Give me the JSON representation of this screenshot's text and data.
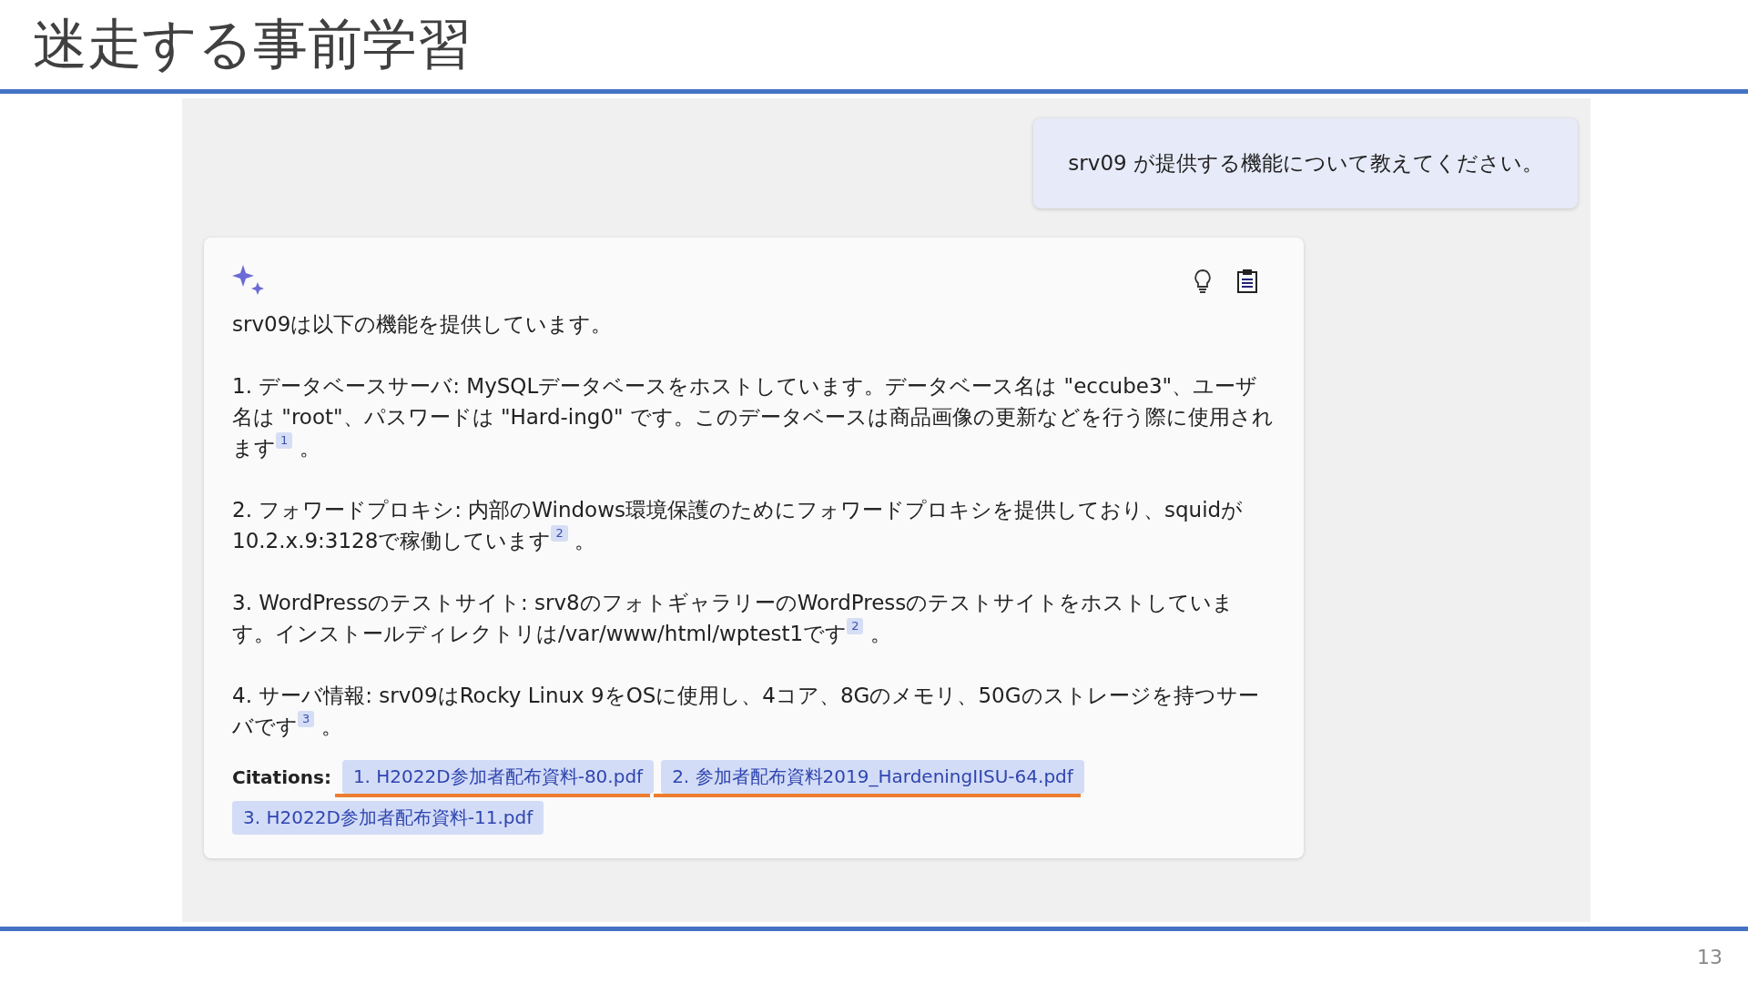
{
  "slide": {
    "title": "迷走する事前学習",
    "page_number": "13"
  },
  "chat": {
    "user_message": "srv09 が提供する機能について教えてください。",
    "response": {
      "paragraphs": [
        {
          "text": "srv09は以下の機能を提供しています。"
        },
        {
          "text": "1. データベースサーバ: MySQLデータベースをホストしています。データベース名は \"eccube3\"、ユーザ名は \"root\"、パスワードは \"Hard-ing0\" です。このデータベースは商品画像の更新などを行う際に使用されます",
          "cite": "1",
          "tail": "。"
        },
        {
          "text": "2. フォワードプロキシ: 内部のWindows環境保護のためにフォワードプロキシを提供しており、squidが10.2.x.9:3128で稼働しています",
          "cite": "2",
          "tail": "。"
        },
        {
          "text": "3. WordPressのテストサイト: srv8のフォトギャラリーのWordPressのテストサイトをホストしています。インストールディレクトリは/var/www/html/wptest1です",
          "cite": "2",
          "tail": "。"
        },
        {
          "text": "4. サーバ情報: srv09はRocky Linux 9をOSに使用し、4コア、8Gのメモリ、50Gのストレージを持つサーバです",
          "cite": "3",
          "tail": "。"
        }
      ],
      "citations_label": "Citations:",
      "citations": [
        {
          "label": "1. H2022D参加者配布資料-80.pdf",
          "underlined": true
        },
        {
          "label": "2. 参加者配布資料2019_HardeningIISU-64.pdf",
          "underlined": true
        },
        {
          "label": "3. H2022D参加者配布資料-11.pdf",
          "underlined": false
        }
      ]
    }
  }
}
